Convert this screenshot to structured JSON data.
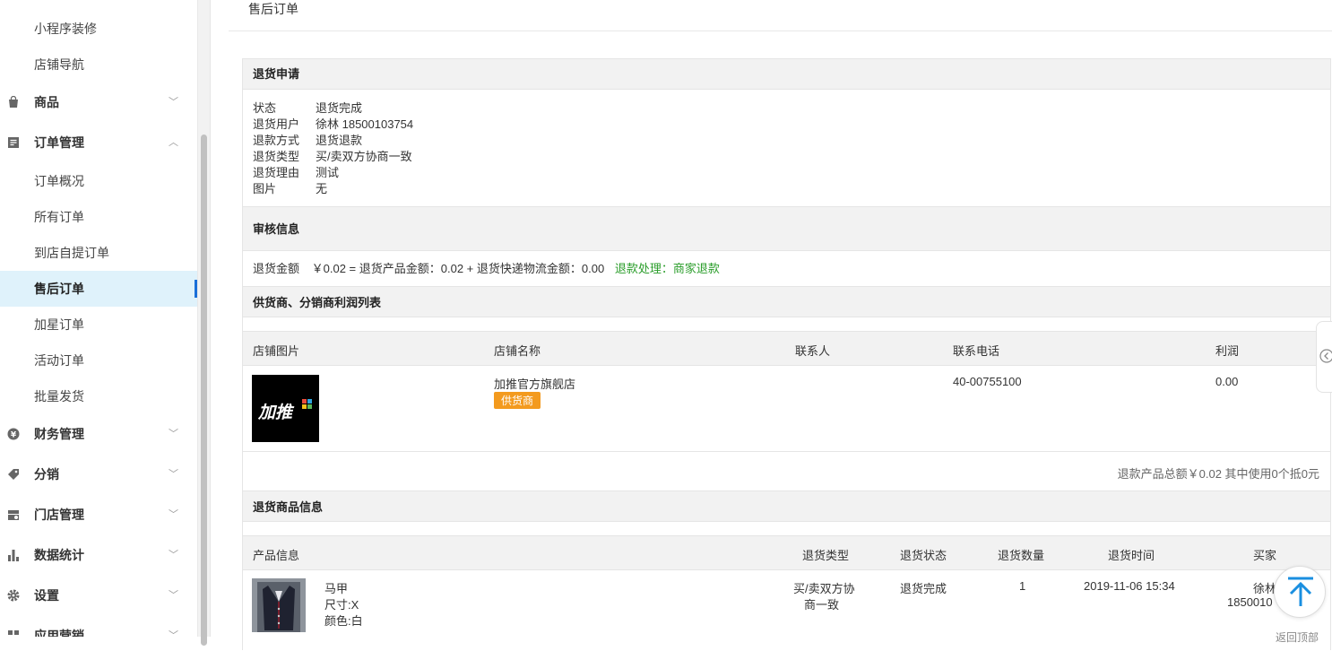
{
  "sidebar": {
    "items": [
      {
        "label": "小程序装修"
      },
      {
        "label": "店铺导航"
      },
      {
        "label": "商品"
      },
      {
        "label": "订单管理"
      },
      {
        "label": "订单概况"
      },
      {
        "label": "所有订单"
      },
      {
        "label": "到店自提订单"
      },
      {
        "label": "售后订单"
      },
      {
        "label": "加星订单"
      },
      {
        "label": "活动订单"
      },
      {
        "label": "批量发货"
      },
      {
        "label": "财务管理"
      },
      {
        "label": "分销"
      },
      {
        "label": "门店管理"
      },
      {
        "label": "数据统计"
      },
      {
        "label": "设置"
      },
      {
        "label": "应用营销"
      }
    ]
  },
  "page": {
    "title": "售后订单"
  },
  "return_request": {
    "heading": "退货申请",
    "rows": [
      {
        "k": "状态",
        "v": "退货完成"
      },
      {
        "k": "退货用户",
        "v": "徐林 18500103754"
      },
      {
        "k": "退款方式",
        "v": "退货退款"
      },
      {
        "k": "退货类型",
        "v": "买/卖双方协商一致"
      },
      {
        "k": "退货理由",
        "v": "测试"
      },
      {
        "k": "图片",
        "v": "无"
      }
    ]
  },
  "review": {
    "heading": "审核信息",
    "amount_label": "退货金额",
    "amount_formula": "￥0.02 = 退货产品金额：0.02 + 退货快递物流金额：0.00",
    "handling": "退款处理：商家退款",
    "handling_color": "#2a9d2a"
  },
  "profit": {
    "heading": "供货商、分销商利润列表",
    "columns": [
      "店铺图片",
      "店铺名称",
      "联系人",
      "联系电话",
      "利润"
    ],
    "row": {
      "logo_text": "加推",
      "store_name": "加推官方旗舰店",
      "badge": "供货商",
      "contact": "",
      "phone": "40-00755100",
      "profit": "0.00"
    },
    "summary": "退款产品总额￥0.02 其中使用0个抵0元"
  },
  "goods": {
    "heading": "退货商品信息",
    "columns": [
      "产品信息",
      "退货类型",
      "退货状态",
      "退货数量",
      "退货时间",
      "买家"
    ],
    "row": {
      "name": "马甲",
      "spec1": "尺寸:X",
      "spec2": "颜色:白",
      "type_line1": "买/卖双方协",
      "type_line2": "商一致",
      "status": "退货完成",
      "qty": "1",
      "time": "2019-11-06 15:34",
      "buyer_line1": "徐林",
      "buyer_line2": "1850010"
    },
    "back_top_label": "返回顶部"
  }
}
